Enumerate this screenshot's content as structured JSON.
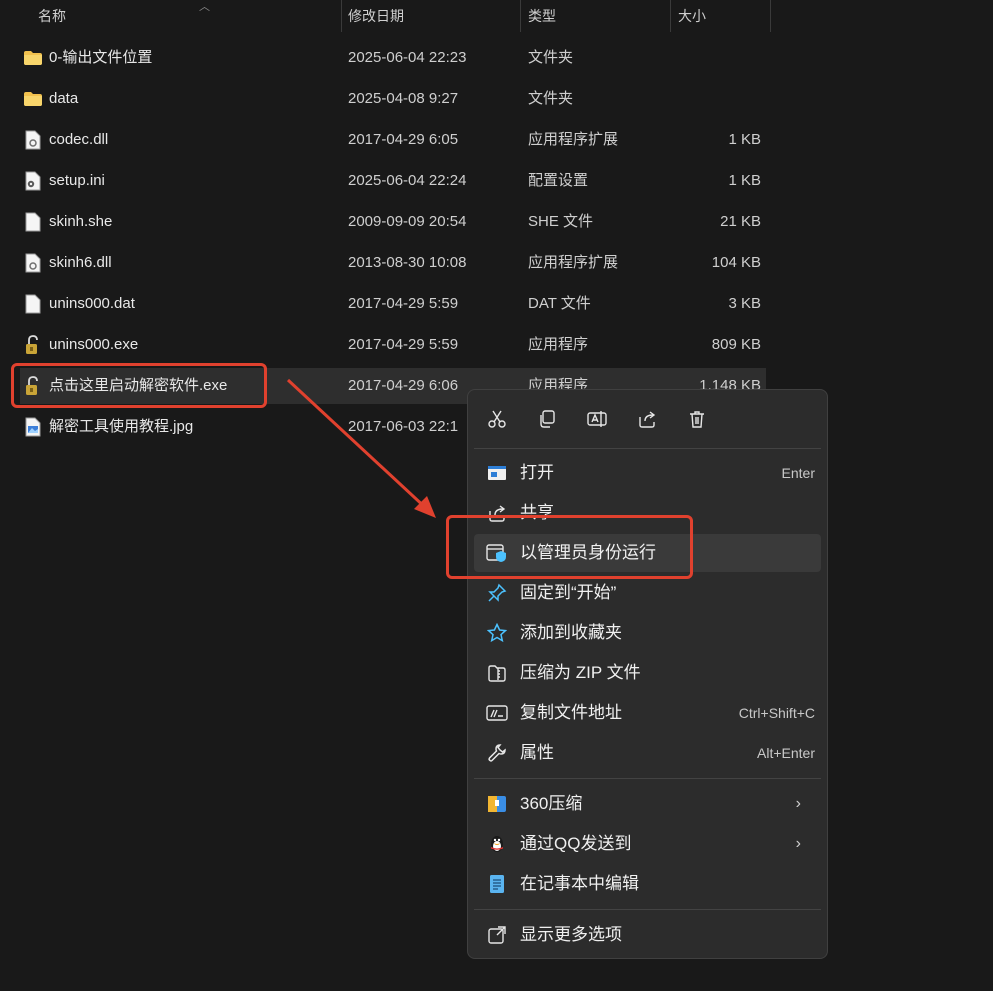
{
  "columns": {
    "name": "名称",
    "date": "修改日期",
    "type": "类型",
    "size": "大小"
  },
  "files": [
    {
      "icon": "folder-icon",
      "name": "0-输出文件位置",
      "date": "2025-06-04 22:23",
      "type": "文件夹",
      "size": ""
    },
    {
      "icon": "folder-icon",
      "name": "data",
      "date": "2025-04-08 9:27",
      "type": "文件夹",
      "size": ""
    },
    {
      "icon": "dll-file-icon",
      "name": "codec.dll",
      "date": "2017-04-29 6:05",
      "type": "应用程序扩展",
      "size": "1 KB"
    },
    {
      "icon": "settings-file-icon",
      "name": "setup.ini",
      "date": "2025-06-04 22:24",
      "type": "配置设置",
      "size": "1 KB"
    },
    {
      "icon": "generic-file-icon",
      "name": "skinh.she",
      "date": "2009-09-09 20:54",
      "type": "SHE 文件",
      "size": "21 KB"
    },
    {
      "icon": "dll-file-icon",
      "name": "skinh6.dll",
      "date": "2013-08-30 10:08",
      "type": "应用程序扩展",
      "size": "104 KB"
    },
    {
      "icon": "generic-file-icon",
      "name": "unins000.dat",
      "date": "2017-04-29 5:59",
      "type": "DAT 文件",
      "size": "3 KB"
    },
    {
      "icon": "installer-exe-icon",
      "name": "unins000.exe",
      "date": "2017-04-29 5:59",
      "type": "应用程序",
      "size": "809 KB"
    },
    {
      "icon": "installer-exe-icon",
      "name": "点击这里启动解密软件.exe",
      "date": "2017-04-29 6:06",
      "type": "应用程序",
      "size": "1,148 KB"
    },
    {
      "icon": "image-file-icon",
      "name": "解密工具使用教程.jpg",
      "date": "2017-06-03 22:1",
      "type": "",
      "size": ""
    }
  ],
  "context_menu": {
    "quick_actions": [
      {
        "icon": "cut-icon"
      },
      {
        "icon": "copy-icon"
      },
      {
        "icon": "rename-icon"
      },
      {
        "icon": "share-icon"
      },
      {
        "icon": "delete-icon"
      }
    ],
    "items": [
      {
        "icon": "open-icon",
        "label": "打开",
        "shortcut": "Enter"
      },
      {
        "icon": "share-icon",
        "label": "共享",
        "shortcut": ""
      },
      {
        "icon": "run-as-admin-icon",
        "label": "以管理员身份运行",
        "shortcut": ""
      },
      {
        "icon": "pin-icon",
        "label": "固定到“开始”",
        "shortcut": ""
      },
      {
        "icon": "star-icon",
        "label": "添加到收藏夹",
        "shortcut": ""
      },
      {
        "icon": "zip-icon",
        "label": "压缩为 ZIP 文件",
        "shortcut": ""
      },
      {
        "icon": "copy-path-icon",
        "label": "复制文件地址",
        "shortcut": "Ctrl+Shift+C"
      },
      {
        "icon": "wrench-icon",
        "label": "属性",
        "shortcut": "Alt+Enter"
      },
      {
        "icon": "compress-360-icon",
        "label": "360压缩",
        "shortcut": ""
      },
      {
        "icon": "qq-penguin-icon",
        "label": "通过QQ发送到",
        "shortcut": ""
      },
      {
        "icon": "notepad-icon",
        "label": "在记事本中编辑",
        "shortcut": ""
      },
      {
        "icon": "more-options-icon",
        "label": "显示更多选项",
        "shortcut": ""
      }
    ]
  },
  "colors": {
    "background": "#191919",
    "menu_background": "#2c2c2c",
    "accent": "#4cc2ff",
    "annotation": "#e0412e",
    "folder": "#f2c14e"
  }
}
